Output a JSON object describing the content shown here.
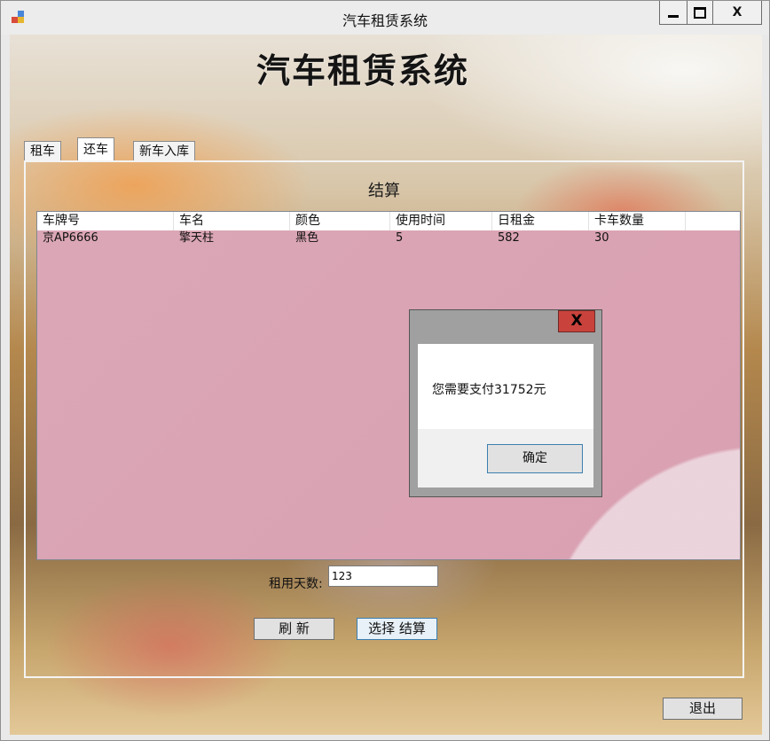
{
  "window": {
    "title": "汽车租赁系统",
    "controls": {
      "minimize_icon": "minimize-icon",
      "maximize_icon": "maximize-icon",
      "close": "X"
    }
  },
  "header": {
    "title": "汽车租赁系统"
  },
  "tabs": [
    {
      "label": "租车",
      "active": false
    },
    {
      "label": "还车",
      "active": true
    },
    {
      "label": "新车入库",
      "active": false
    }
  ],
  "return_panel": {
    "section_title": "结算",
    "table": {
      "columns": [
        "车牌号",
        "车名",
        "颜色",
        "使用时间",
        "日租金",
        "卡车数量"
      ],
      "rows": [
        [
          "京AP6666",
          "擎天柱",
          "黑色",
          "5",
          "582",
          "30"
        ]
      ]
    },
    "days_label": "租用天数:",
    "days_value": "123",
    "refresh_label": "刷  新",
    "select_settle_label": "选择  结算"
  },
  "exit_label": "退出",
  "message_box": {
    "close": "X",
    "text": "您需要支付31752元",
    "ok_label": "确定"
  },
  "colors": {
    "listview_bg": "#dba7b6",
    "close_red": "#c9433c",
    "focus_blue": "#3c7fb1"
  }
}
